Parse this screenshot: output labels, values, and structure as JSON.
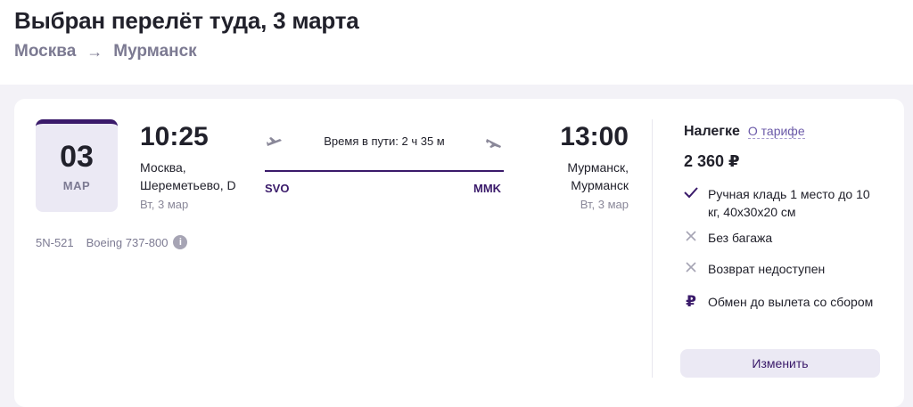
{
  "header": {
    "title": "Выбран перелёт туда, 3 марта",
    "route_from": "Москва",
    "route_arrow": "→",
    "route_to": "Мурманск"
  },
  "flight": {
    "date_day": "03",
    "date_month": "МАР",
    "departure": {
      "time": "10:25",
      "place_line1": "Москва,",
      "place_line2": "Шереметьево, D",
      "date": "Вт, 3 мар",
      "code": "SVO"
    },
    "arrival": {
      "time": "13:00",
      "place_line1": "Мурманск,",
      "place_line2": "Мурманск",
      "date": "Вт, 3 мар",
      "code": "MMK"
    },
    "duration": "Время в пути: 2 ч 35 м",
    "number": "5N-521",
    "aircraft": "Boeing 737-800"
  },
  "tariff": {
    "name": "Налегке",
    "link": "О тарифе",
    "price": "2 360 ₽",
    "features": [
      {
        "icon": "check-icon",
        "text": "Ручная кладь 1 место до 10 кг, 40х30х20 см"
      },
      {
        "icon": "cross-icon",
        "text": "Без багажа"
      },
      {
        "icon": "cross-icon",
        "text": "Возврат недоступен"
      },
      {
        "icon": "ruble-icon",
        "text": "Обмен до вылета со сбором"
      }
    ],
    "change_button": "Изменить"
  },
  "colors": {
    "accent": "#3a1a6a",
    "muted": "#7c7a92",
    "background_band": "#f3f2f7"
  }
}
